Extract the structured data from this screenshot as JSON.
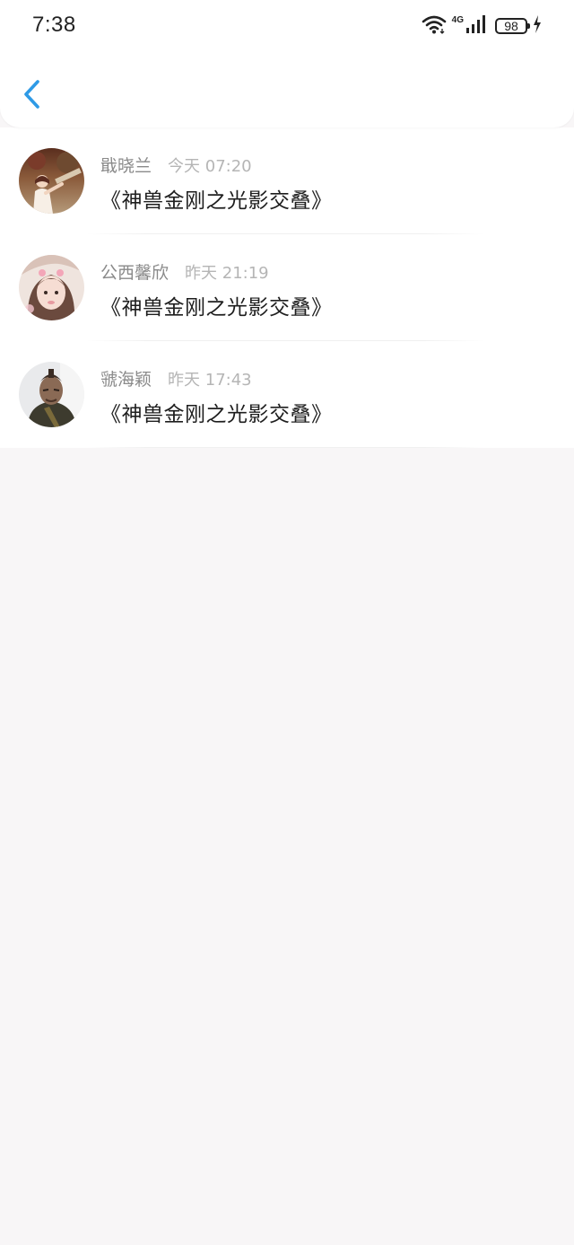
{
  "status_bar": {
    "time": "7:38",
    "network": "4G",
    "battery": "98"
  },
  "nav": {
    "back_icon": "chevron-left-icon",
    "accent_color": "#2e9ae6"
  },
  "items": [
    {
      "name": "戢晓兰",
      "time": "今天 07:20",
      "title": "《神兽金刚之光影交叠》",
      "avatar": "avatar-photo-outdoor"
    },
    {
      "name": "公西馨欣",
      "time": "昨天 21:19",
      "title": "《神兽金刚之光影交叠》",
      "avatar": "avatar-photo-girl"
    },
    {
      "name": "虢海颖",
      "time": "昨天 17:43",
      "title": "《神兽金刚之光影交叠》",
      "avatar": "avatar-photo-soldier"
    }
  ]
}
